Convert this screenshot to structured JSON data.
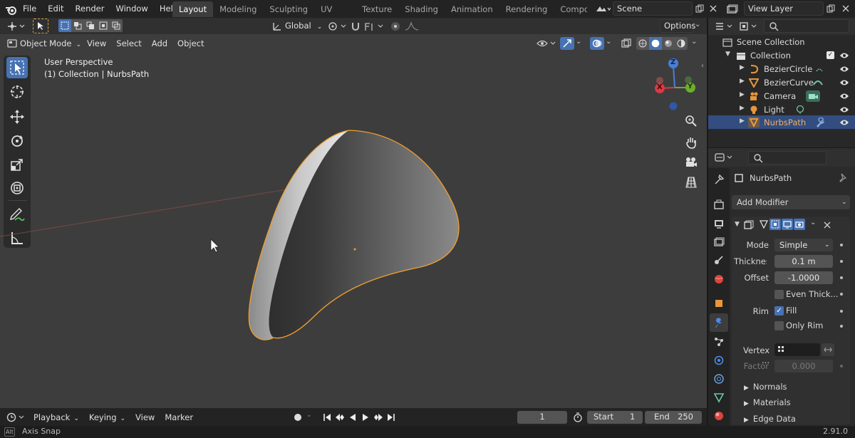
{
  "topbar": {
    "menus": [
      "File",
      "Edit",
      "Render",
      "Window",
      "Help"
    ],
    "workspaces": [
      {
        "label": "Layout",
        "active": true
      },
      {
        "label": "Modeling",
        "active": false
      },
      {
        "label": "Sculpting",
        "active": false
      },
      {
        "label": "UV Editing",
        "active": false
      },
      {
        "label": "Texture Paint",
        "active": false
      },
      {
        "label": "Shading",
        "active": false
      },
      {
        "label": "Animation",
        "active": false
      },
      {
        "label": "Rendering",
        "active": false
      },
      {
        "label": "Compos",
        "active": false
      }
    ],
    "scene": "Scene",
    "view_layer": "View Layer"
  },
  "viewport_header": {
    "transform_orientation": "Global",
    "options_label": "Options",
    "mode": "Object Mode",
    "menus": [
      "View",
      "Select",
      "Add",
      "Object"
    ]
  },
  "viewport": {
    "perspective_label": "User Perspective",
    "collection_label": "(1) Collection | NurbsPath",
    "gizmo_axes": {
      "z": "Z",
      "y": "Y",
      "x": "X"
    }
  },
  "outliner": {
    "root": "Scene Collection",
    "collection": "Collection",
    "objects": [
      {
        "name": "BezierCircle",
        "icon": "curve-icon",
        "color": "#e8963a",
        "selected": false
      },
      {
        "name": "BezierCurve",
        "icon": "curve-icon",
        "color": "#e8963a",
        "selected": false
      },
      {
        "name": "Camera",
        "icon": "camera-icon",
        "color": "#e8963a",
        "selected": false
      },
      {
        "name": "Light",
        "icon": "light-icon",
        "color": "#e8963a",
        "selected": false
      },
      {
        "name": "NurbsPath",
        "icon": "curve-icon",
        "color": "#e8963a",
        "selected": true
      }
    ]
  },
  "properties": {
    "object_name": "NurbsPath",
    "add_modifier_label": "Add Modifier",
    "solidify": {
      "mode_label": "Mode",
      "mode_value": "Simple",
      "thickness_label": "Thicknes",
      "thickness_value": "0.1 m",
      "offset_label": "Offset",
      "offset_value": "-1.0000",
      "even_thickness_label": "Even Thick...",
      "rim_label": "Rim",
      "fill_label": "Fill",
      "only_rim_label": "Only Rim",
      "vertex_group_label": "Vertex ...",
      "factor_label": "Factor",
      "factor_value": "0.000"
    },
    "subpanels": [
      "Normals",
      "Materials",
      "Edge Data"
    ]
  },
  "timeline": {
    "menus": [
      "Playback",
      "Keying",
      "View",
      "Marker"
    ],
    "current_frame": "1",
    "start_label": "Start",
    "start_value": "1",
    "end_label": "End",
    "end_value": "250"
  },
  "statusbar": {
    "key": "Alt",
    "hint": "Axis Snap",
    "version": "2.91.0"
  },
  "colors": {
    "accent": "#4772b3",
    "selection_orange": "#f0a030",
    "viewport_bg": "#3d3d3d"
  }
}
